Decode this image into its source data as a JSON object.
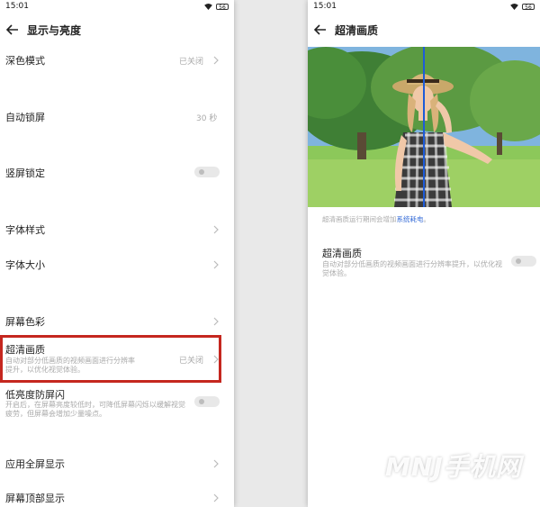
{
  "colors": {
    "highlight": "#c5271f",
    "link": "#3a6fd8",
    "muted": "#aaaaaa"
  },
  "left": {
    "status": {
      "time": "15:01",
      "battery": "56"
    },
    "header": {
      "title": "显示与亮度"
    },
    "items": [
      {
        "title": "深色模式",
        "value": "已关闭"
      },
      {
        "title": "自动锁屏",
        "value": "30 秒"
      },
      {
        "title": "竖屏锁定"
      },
      {
        "title": "字体样式"
      },
      {
        "title": "字体大小"
      },
      {
        "title": "屏幕色彩"
      },
      {
        "title": "超清画质",
        "desc": "自动对部分低画质的视频画面进行分辨率提升，以优化视觉体验。",
        "value": "已关闭"
      },
      {
        "title": "低亮度防屏闪",
        "desc": "开启后，在屏幕亮度较低时，可降低屏幕闪烁以缓解视觉疲劳，但屏幕会增加少量噪点。"
      },
      {
        "title": "应用全屏显示"
      },
      {
        "title": "屏幕顶部显示"
      }
    ]
  },
  "right": {
    "status": {
      "time": "15:01",
      "battery": "56"
    },
    "header": {
      "title": "超清画质"
    },
    "note": {
      "text": "超清画质运行期间会增加",
      "link": "系统耗电",
      "end": "。"
    },
    "setting": {
      "title": "超清画质",
      "desc": "自动对部分低画质的视频画面进行分辨率提升，以优化视觉体验。"
    }
  },
  "watermark": "MNJ手机网"
}
